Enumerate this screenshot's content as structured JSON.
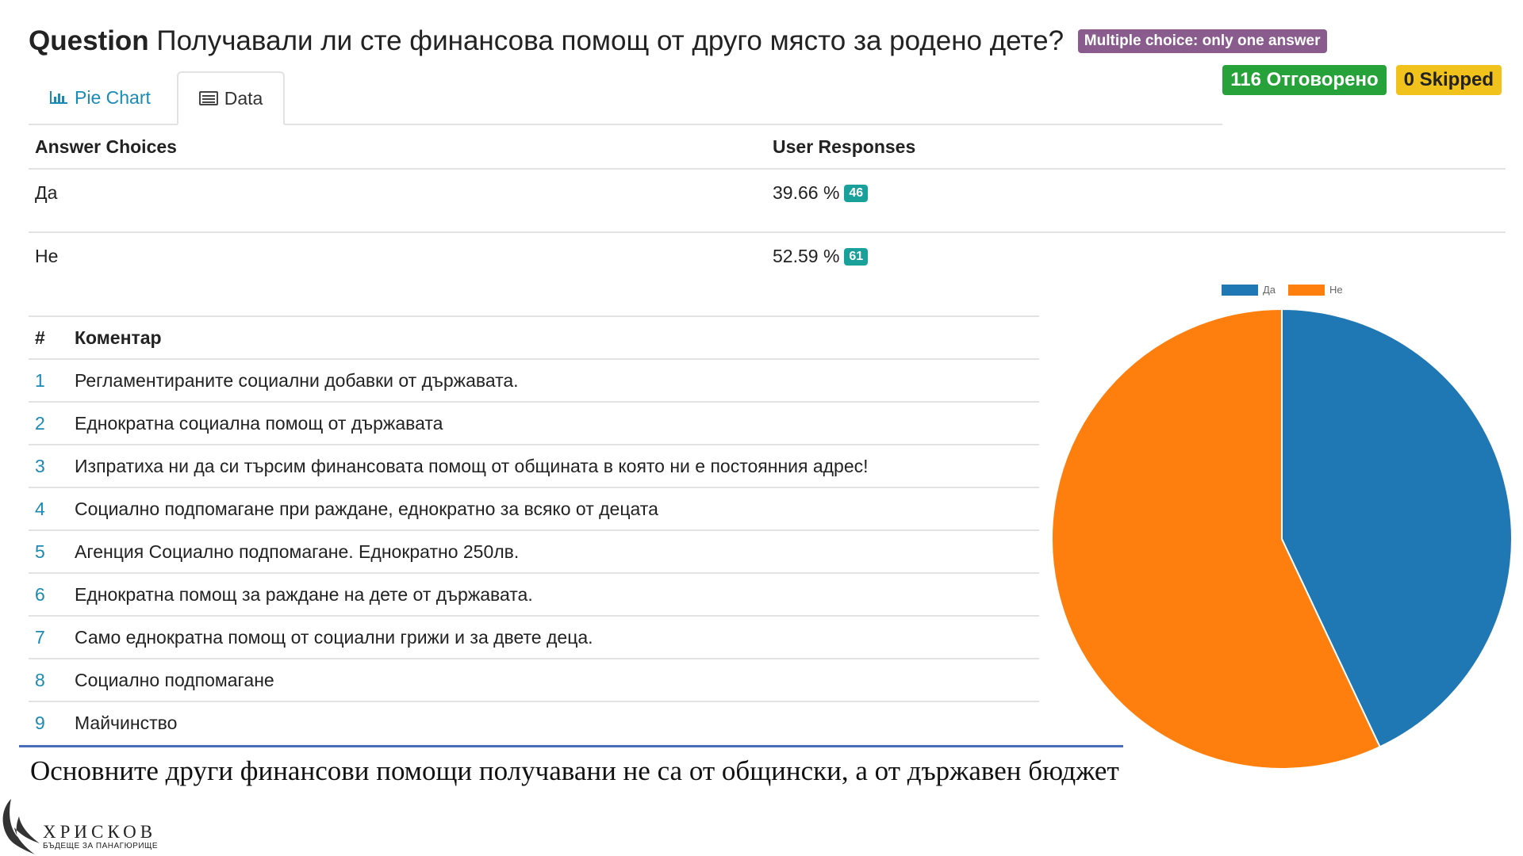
{
  "question": {
    "label": "Question",
    "text": "Получавали ли сте финансова помощ от друго място за родено дете?",
    "type_badge": "Multiple choice: only one answer"
  },
  "stats": {
    "answered": "116 Отговорено",
    "skipped": "0 Skipped"
  },
  "tabs": [
    {
      "label": "Pie Chart",
      "icon": "bar-chart-icon",
      "active": false
    },
    {
      "label": "Data",
      "icon": "list-icon",
      "active": true
    }
  ],
  "responses": {
    "headers": {
      "choice": "Answer Choices",
      "responses": "User Responses"
    },
    "rows": [
      {
        "choice": "Да",
        "percent": "39.66 %",
        "count": "46"
      },
      {
        "choice": "Не",
        "percent": "52.59 %",
        "count": "61"
      }
    ]
  },
  "comments": {
    "headers": {
      "num": "#",
      "text": "Коментар"
    },
    "rows": [
      {
        "num": "1",
        "text": "Регламентираните социални добавки от държавата."
      },
      {
        "num": "2",
        "text": "Еднократна социална помощ от държавата"
      },
      {
        "num": "3",
        "text": "Изпратиха ни да си търсим финансовата помощ от общината в която ни е постоянния адрес!"
      },
      {
        "num": "4",
        "text": "Социално подпомагане при раждане, еднократно за всяко от децата"
      },
      {
        "num": "5",
        "text": "Агенция Социално подпомагане. Еднократно 250лв."
      },
      {
        "num": "6",
        "text": "Еднократна помощ за раждане на дете от държавата."
      },
      {
        "num": "7",
        "text": "Само еднократна помощ от социални грижи и за двете деца."
      },
      {
        "num": "8",
        "text": "Социално подпомагане"
      },
      {
        "num": "9",
        "text": "Майчинство"
      }
    ]
  },
  "conclusion": "Основните други финансови помощи получавани не са от общински, а от държавен бюджет",
  "logo": {
    "name": "ХРИСКОВ",
    "subtitle": "БЪДЕЩЕ ЗА ПАНАГЮРИЩЕ"
  },
  "colors": {
    "accent": "#1a8bb5",
    "answered": "#27a23a",
    "skipped": "#f1c21b",
    "type_badge": "#8a5c8e",
    "count_badge": "#1aa09a"
  },
  "chart_data": {
    "type": "pie",
    "categories": [
      "Да",
      "Не"
    ],
    "values": [
      46,
      61
    ],
    "colors": [
      "#1f77b4",
      "#ff7f0e"
    ],
    "legend": "top"
  }
}
